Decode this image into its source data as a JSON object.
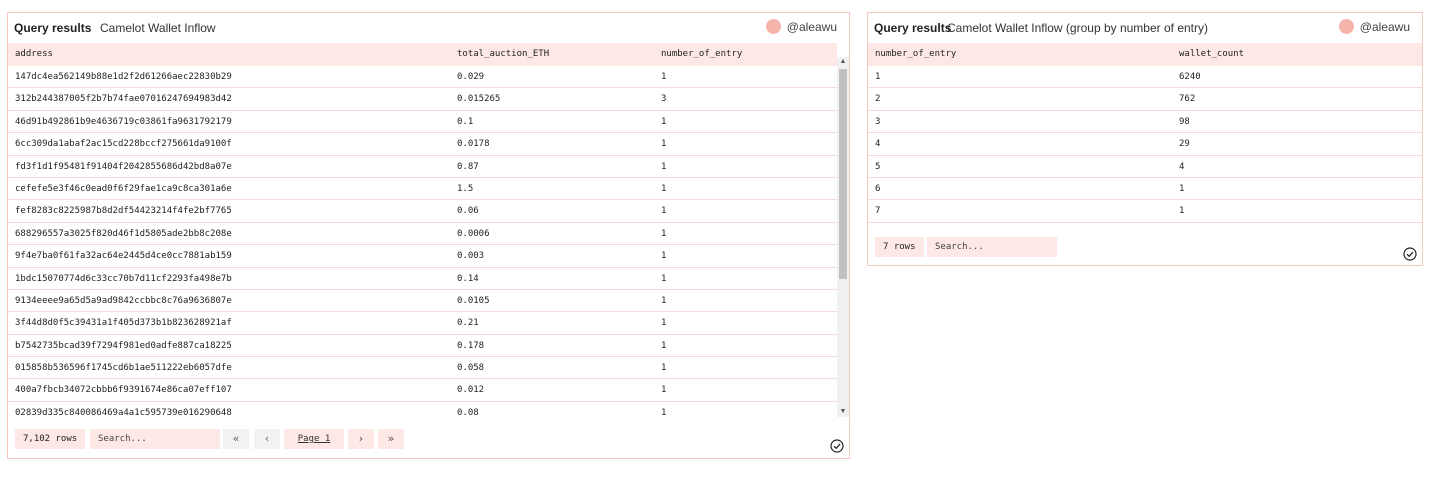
{
  "left_panel": {
    "label": "Query results",
    "title": "Camelot Wallet Inflow",
    "user": "@aleawu",
    "columns": [
      "address",
      "total_auction_ETH",
      "number_of_entry"
    ],
    "rows": [
      [
        "147dc4ea562149b88e1d2f2d61266aec22830b29",
        "0.029",
        "1"
      ],
      [
        "312b244387005f2b7b74fae07016247694983d42",
        "0.015265",
        "3"
      ],
      [
        "46d91b492861b9e4636719c03861fa9631792179",
        "0.1",
        "1"
      ],
      [
        "6cc309da1abaf2ac15cd228bccf275661da9100f",
        "0.0178",
        "1"
      ],
      [
        "fd3f1d1f95481f91404f2042855686d42bd8a07e",
        "0.87",
        "1"
      ],
      [
        "cefefe5e3f46c0ead0f6f29fae1ca9c8ca301a6e",
        "1.5",
        "1"
      ],
      [
        "fef8283c8225987b8d2df54423214f4fe2bf7765",
        "0.06",
        "1"
      ],
      [
        "688296557a3025f820d46f1d5805ade2bb8c208e",
        "0.0006",
        "1"
      ],
      [
        "9f4e7ba0f61fa32ac64e2445d4ce0cc7881ab159",
        "0.003",
        "1"
      ],
      [
        "1bdc15070774d6c33cc70b7d11cf2293fa498e7b",
        "0.14",
        "1"
      ],
      [
        "9134eeee9a65d5a9ad9842ccbbc8c76a9636807e",
        "0.0105",
        "1"
      ],
      [
        "3f44d8d0f5c39431a1f405d373b1b823628921af",
        "0.21",
        "1"
      ],
      [
        "b7542735bcad39f7294f981ed0adfe887ca18225",
        "0.178",
        "1"
      ],
      [
        "015858b536596f1745cd6b1ae511222eb6057dfe",
        "0.058",
        "1"
      ],
      [
        "400a7fbcb34072cbbb6f9391674e86ca07eff107",
        "0.012",
        "1"
      ],
      [
        "02839d335c840086469a4a1c595739e016290648",
        "0.08",
        "1"
      ]
    ],
    "row_count": "7,102 rows",
    "search_placeholder": "Search...",
    "pagination": {
      "first": "«",
      "prev": "‹",
      "page": "Page 1",
      "next": "›",
      "last": "»"
    }
  },
  "right_panel": {
    "label": "Query results",
    "title": "Camelot Wallet Inflow (group by number of entry)",
    "user": "@aleawu",
    "columns": [
      "number_of_entry",
      "wallet_count"
    ],
    "rows": [
      [
        "1",
        "6240"
      ],
      [
        "2",
        "762"
      ],
      [
        "3",
        "98"
      ],
      [
        "4",
        "29"
      ],
      [
        "5",
        "4"
      ],
      [
        "6",
        "1"
      ],
      [
        "7",
        "1"
      ]
    ],
    "row_count": "7 rows",
    "search_placeholder": "Search..."
  },
  "colors": {
    "border": "#f4c9c2",
    "header_bg": "#fde8e6",
    "avatar": "#f6b3aa"
  },
  "icons": {
    "avatar": "avatar-dot",
    "status": "check-circle-icon"
  }
}
